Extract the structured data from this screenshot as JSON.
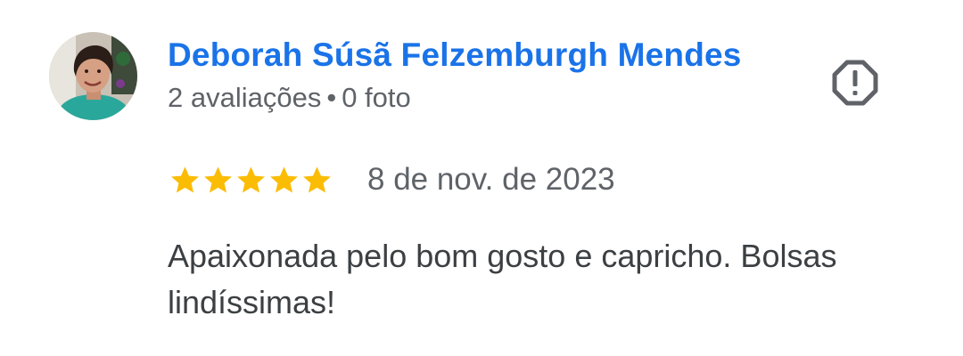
{
  "review": {
    "author_name": "Deborah Súsã Felzemburgh Mendes",
    "review_count": "2 avaliações",
    "separator": "•",
    "photo_count": "0 foto",
    "rating": 5,
    "rating_max": 5,
    "date": "8 de nov. de 2023",
    "text": "Apaixonada pelo bom gosto e capricho. Bolsas lindíssimas!"
  },
  "icons": {
    "flag": "report-flag-icon",
    "star": "star-icon"
  },
  "colors": {
    "author_name": "#1a73e8",
    "secondary_text": "#5f6368",
    "body_text": "#3c4043",
    "star": "#fbbc04",
    "icon": "#5f6368"
  }
}
